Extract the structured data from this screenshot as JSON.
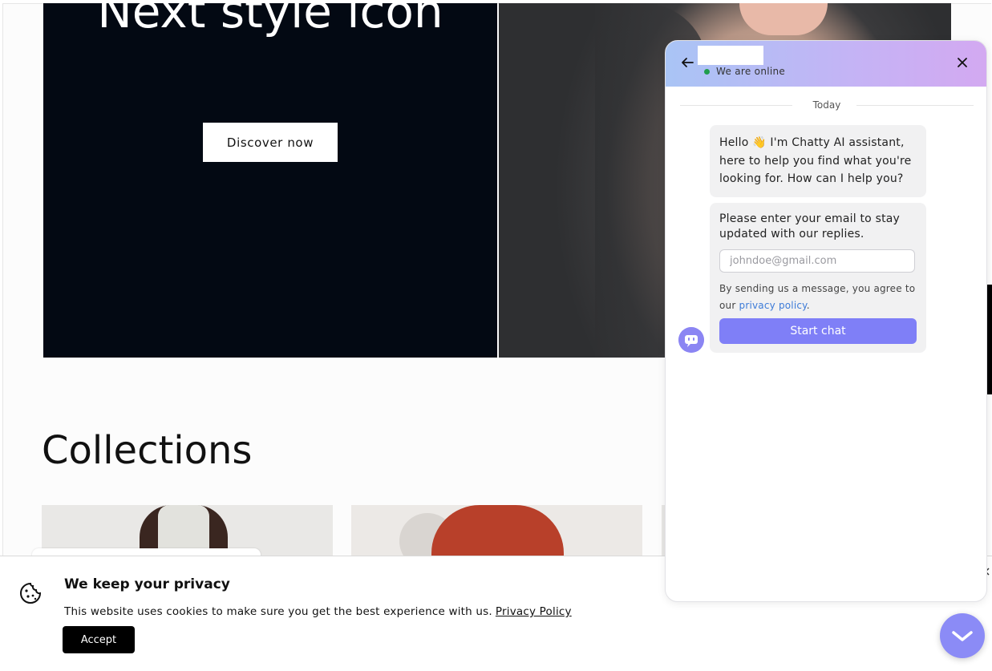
{
  "hero": {
    "title": "Next style icon",
    "button_label": "Discover now"
  },
  "collections": {
    "title": "Collections"
  },
  "cookie_banner": {
    "title": "We keep your privacy",
    "message": "This website uses cookies to make sure you get the best experience with us.",
    "policy_link": "Privacy Policy",
    "accept_label": "Accept",
    "icon": "cookie-icon"
  },
  "chat": {
    "status": "We are online",
    "day_separator": "Today",
    "greeting": "Hello 👋 I'm Chatty AI assistant, here to help you find what you're looking for. How can I help you?",
    "email_prompt": "Please enter your email to stay updated with our replies.",
    "email_placeholder": "johndoe@gmail.com",
    "consent_prefix": "By sending us a message, you agree to our",
    "consent_link": "privacy policy",
    "consent_suffix": ".",
    "start_label": "Start chat",
    "accent_color": "#7f7ff7"
  }
}
